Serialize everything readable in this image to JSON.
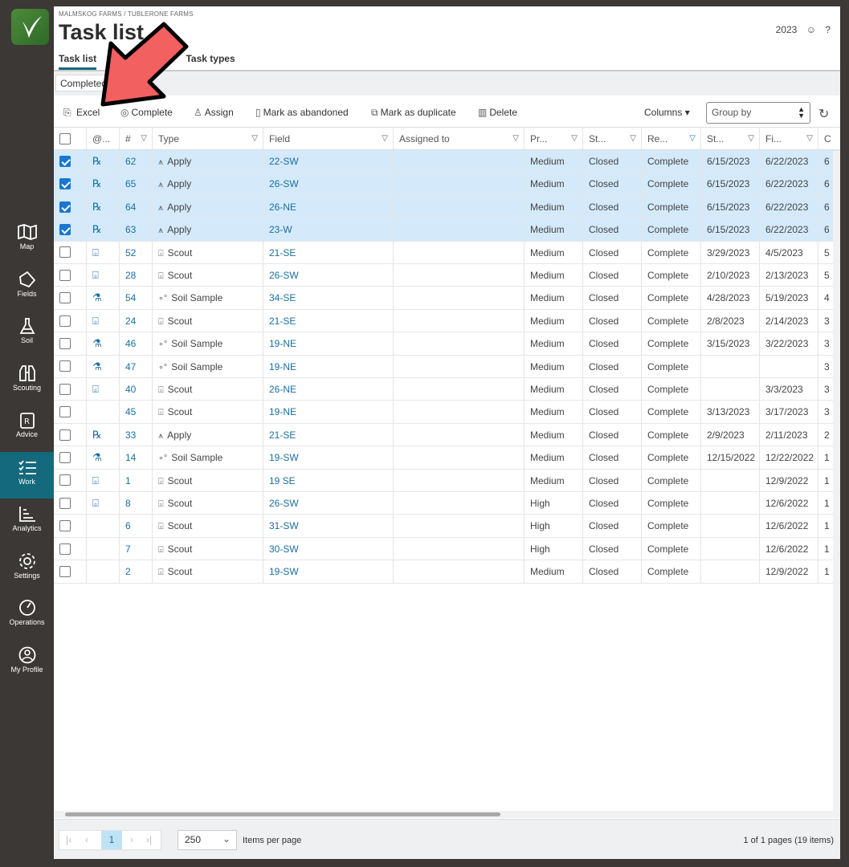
{
  "sidebar": {
    "items": [
      {
        "label": "Map",
        "icon": "map-icon"
      },
      {
        "label": "Fields",
        "icon": "fields-icon"
      },
      {
        "label": "Soil",
        "icon": "flask-icon"
      },
      {
        "label": "Scouting",
        "icon": "binoculars-icon"
      },
      {
        "label": "Advice",
        "icon": "prescription-icon"
      },
      {
        "label": "Work",
        "icon": "checklist-icon",
        "active": true
      },
      {
        "label": "Analytics",
        "icon": "chart-icon"
      },
      {
        "label": "Settings",
        "icon": "gear-icon"
      },
      {
        "label": "Operations",
        "icon": "gauge-icon"
      },
      {
        "label": "My Profile",
        "icon": "user-icon"
      }
    ]
  },
  "header": {
    "breadcrumb": "MALMSKOG FARMS / TUBLERONE FARMS",
    "title": "Task list",
    "year": "2023",
    "help": "?"
  },
  "tabs": [
    "Task list",
    "Task types"
  ],
  "filter": {
    "chip": "Completed"
  },
  "toolbar": {
    "excel": "Excel",
    "complete": "Complete",
    "assign": "Assign",
    "abandon": "Mark as abandoned",
    "duplicate": "Mark as duplicate",
    "delete": "Delete",
    "columns": "Columns",
    "group_by": "Group by"
  },
  "columns": [
    "@...",
    "#",
    "Type",
    "Field",
    "Assigned to",
    "Pr...",
    "St...",
    "Re...",
    "St...",
    "Fi...",
    "C"
  ],
  "rows": [
    {
      "sel": true,
      "icon": "rx",
      "num": "62",
      "type": "Apply",
      "field": "22-SW",
      "pri": "Medium",
      "status": "Closed",
      "res": "Complete",
      "start": "6/15/2023",
      "fin": "6/22/2023",
      "c": "6"
    },
    {
      "sel": true,
      "icon": "rx",
      "num": "65",
      "type": "Apply",
      "field": "26-SW",
      "pri": "Medium",
      "status": "Closed",
      "res": "Complete",
      "start": "6/15/2023",
      "fin": "6/22/2023",
      "c": "6"
    },
    {
      "sel": true,
      "icon": "rx",
      "num": "64",
      "type": "Apply",
      "field": "26-NE",
      "pri": "Medium",
      "status": "Closed",
      "res": "Complete",
      "start": "6/15/2023",
      "fin": "6/22/2023",
      "c": "6"
    },
    {
      "sel": true,
      "icon": "rx",
      "num": "63",
      "type": "Apply",
      "field": "23-W",
      "pri": "Medium",
      "status": "Closed",
      "res": "Complete",
      "start": "6/15/2023",
      "fin": "6/22/2023",
      "c": "6"
    },
    {
      "sel": false,
      "icon": "bino",
      "num": "52",
      "type": "Scout",
      "field": "21-SE",
      "pri": "Medium",
      "status": "Closed",
      "res": "Complete",
      "start": "3/29/2023",
      "fin": "4/5/2023",
      "c": "5"
    },
    {
      "sel": false,
      "icon": "bino",
      "num": "28",
      "type": "Scout",
      "field": "26-SW",
      "pri": "Medium",
      "status": "Closed",
      "res": "Complete",
      "start": "2/10/2023",
      "fin": "2/13/2023",
      "c": "5"
    },
    {
      "sel": false,
      "icon": "flask",
      "num": "54",
      "type": "Soil Sample",
      "field": "34-SE",
      "pri": "Medium",
      "status": "Closed",
      "res": "Complete",
      "start": "4/28/2023",
      "fin": "5/19/2023",
      "c": "4"
    },
    {
      "sel": false,
      "icon": "bino",
      "num": "24",
      "type": "Scout",
      "field": "21-SE",
      "pri": "Medium",
      "status": "Closed",
      "res": "Complete",
      "start": "2/8/2023",
      "fin": "2/14/2023",
      "c": "3"
    },
    {
      "sel": false,
      "icon": "flask",
      "num": "46",
      "type": "Soil Sample",
      "field": "19-NE",
      "pri": "Medium",
      "status": "Closed",
      "res": "Complete",
      "start": "3/15/2023",
      "fin": "3/22/2023",
      "c": "3"
    },
    {
      "sel": false,
      "icon": "flask",
      "num": "47",
      "type": "Soil Sample",
      "field": "19-NE",
      "pri": "Medium",
      "status": "Closed",
      "res": "Complete",
      "start": "",
      "fin": "",
      "c": "3"
    },
    {
      "sel": false,
      "icon": "bino",
      "num": "40",
      "type": "Scout",
      "field": "26-NE",
      "pri": "Medium",
      "status": "Closed",
      "res": "Complete",
      "start": "",
      "fin": "3/3/2023",
      "c": "3"
    },
    {
      "sel": false,
      "icon": "",
      "num": "45",
      "type": "Scout",
      "field": "19-NE",
      "pri": "Medium",
      "status": "Closed",
      "res": "Complete",
      "start": "3/13/2023",
      "fin": "3/17/2023",
      "c": "3"
    },
    {
      "sel": false,
      "icon": "rx",
      "num": "33",
      "type": "Apply",
      "field": "21-SE",
      "pri": "Medium",
      "status": "Closed",
      "res": "Complete",
      "start": "2/9/2023",
      "fin": "2/11/2023",
      "c": "2"
    },
    {
      "sel": false,
      "icon": "flask",
      "num": "14",
      "type": "Soil Sample",
      "field": "19-SW",
      "pri": "Medium",
      "status": "Closed",
      "res": "Complete",
      "start": "12/15/2022",
      "fin": "12/22/2022",
      "c": "1"
    },
    {
      "sel": false,
      "icon": "bino",
      "num": "1",
      "type": "Scout",
      "field": "19 SE",
      "pri": "Medium",
      "status": "Closed",
      "res": "Complete",
      "start": "",
      "fin": "12/9/2022",
      "c": "1"
    },
    {
      "sel": false,
      "icon": "bino",
      "num": "8",
      "type": "Scout",
      "field": "26-SW",
      "pri": "High",
      "status": "Closed",
      "res": "Complete",
      "start": "",
      "fin": "12/6/2022",
      "c": "1"
    },
    {
      "sel": false,
      "icon": "",
      "num": "6",
      "type": "Scout",
      "field": "31-SW",
      "pri": "High",
      "status": "Closed",
      "res": "Complete",
      "start": "",
      "fin": "12/6/2022",
      "c": "1"
    },
    {
      "sel": false,
      "icon": "",
      "num": "7",
      "type": "Scout",
      "field": "30-SW",
      "pri": "High",
      "status": "Closed",
      "res": "Complete",
      "start": "",
      "fin": "12/6/2022",
      "c": "1"
    },
    {
      "sel": false,
      "icon": "",
      "num": "2",
      "type": "Scout",
      "field": "19-SW",
      "pri": "Medium",
      "status": "Closed",
      "res": "Complete",
      "start": "",
      "fin": "12/9/2022",
      "c": "1"
    }
  ],
  "pager": {
    "current_page": "1",
    "per_page": "250",
    "per_page_label": "Items per page",
    "info": "1 of 1 pages (19 items)"
  },
  "colors": {
    "accent": "#146a7c",
    "link": "#1a6fa0",
    "selected_row": "#d4eafb",
    "arrow": "#f26060"
  }
}
